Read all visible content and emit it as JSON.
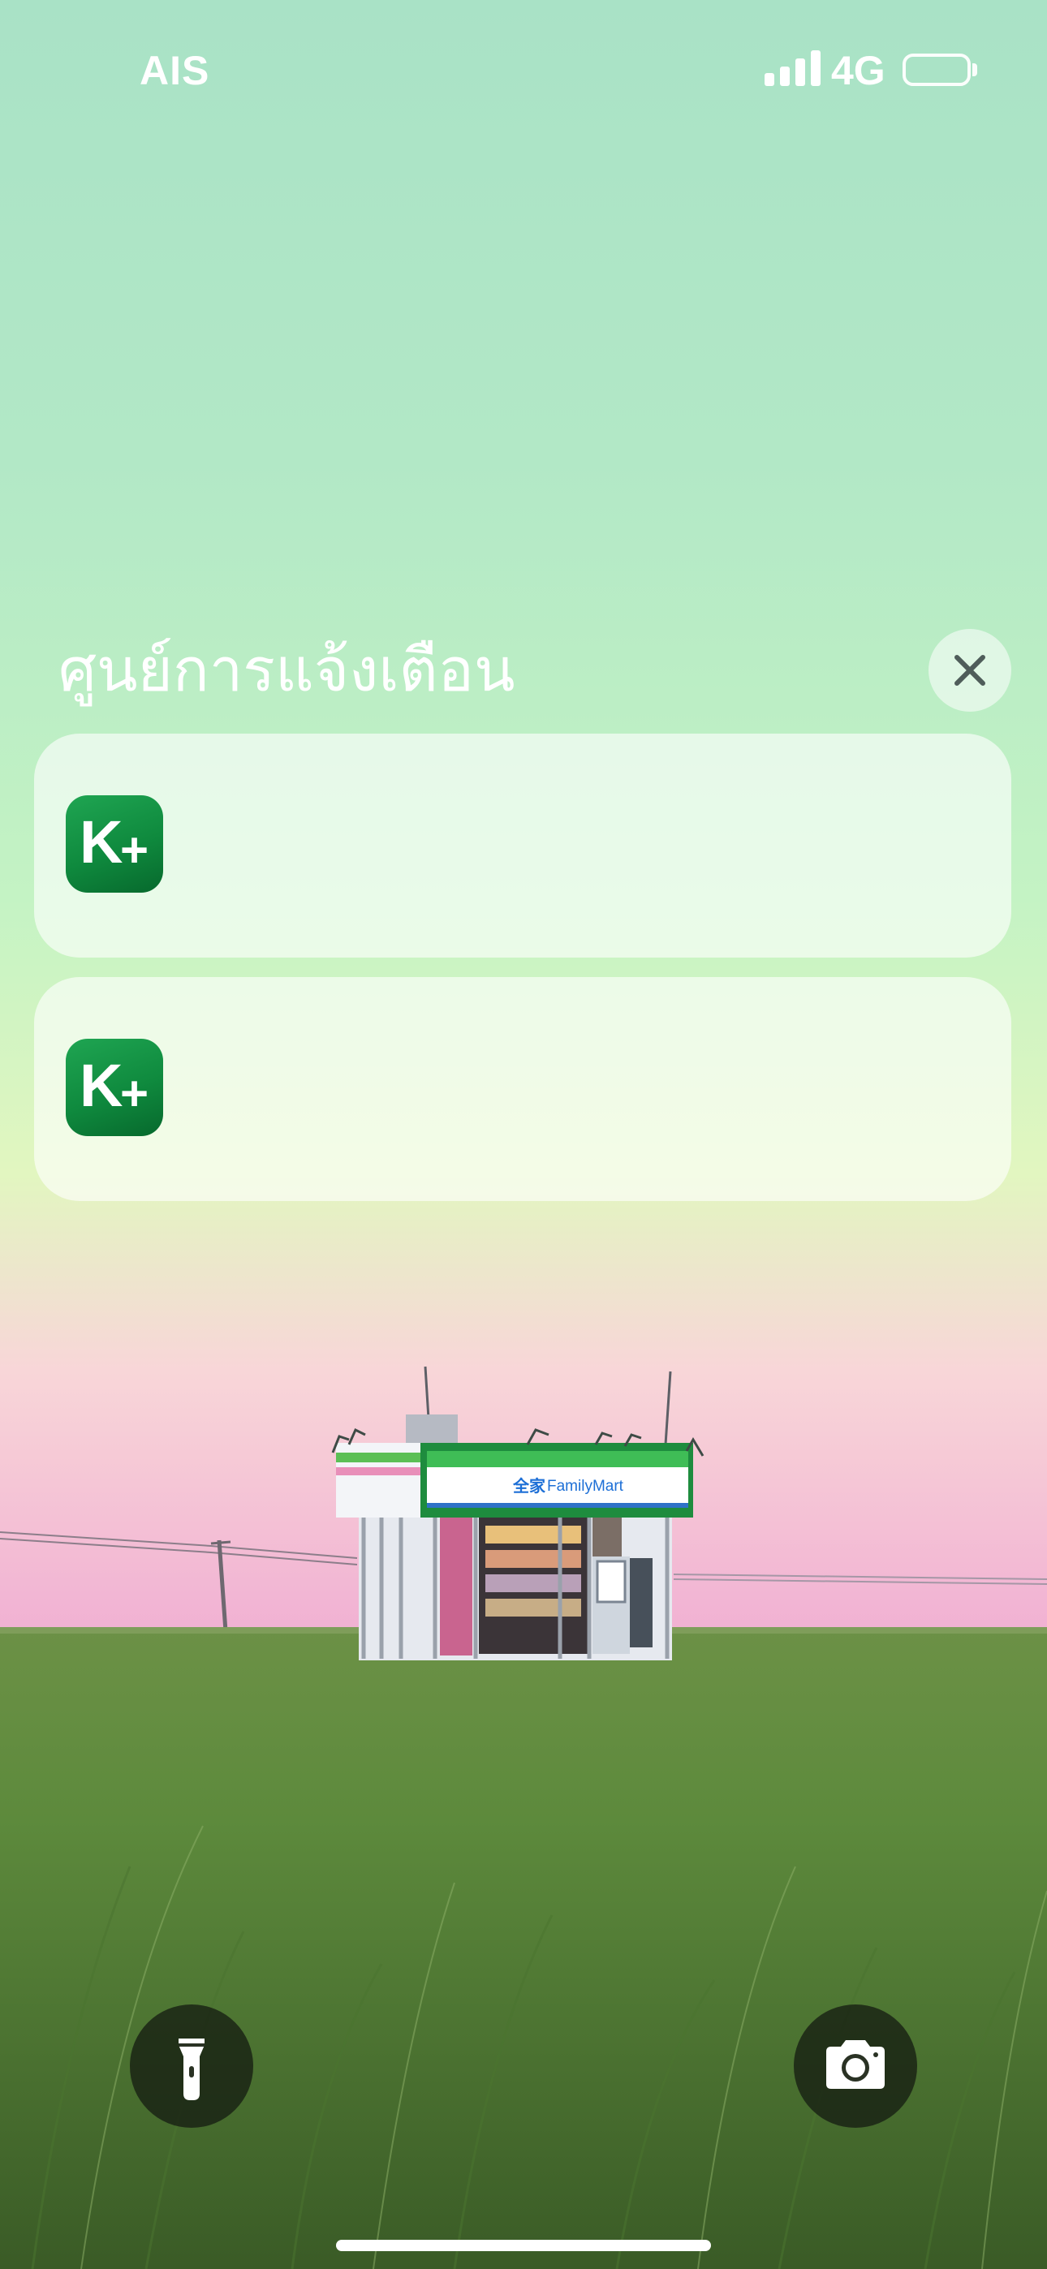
{
  "status_bar": {
    "carrier": "AIS",
    "network": "4G",
    "signal_icon": "cellular-signal-icon",
    "battery_icon": "battery-icon"
  },
  "notification_center": {
    "title": "ศูนย์การแจ้งเตือน",
    "close_icon": "close-icon",
    "notifications": [
      {
        "app_icon_label": "K",
        "app_icon_plus": "+",
        "icon": "kplus-app-icon"
      },
      {
        "app_icon_label": "K",
        "app_icon_plus": "+",
        "icon": "kplus-app-icon"
      }
    ]
  },
  "wallpaper": {
    "store_sign_chinese": "全家",
    "store_sign": "FamilyMart"
  },
  "quick_actions": {
    "flashlight_icon": "flashlight-icon",
    "camera_icon": "camera-icon"
  },
  "colors": {
    "sky_top": "#a9e2c6",
    "sky_pink": "#f3b3d4",
    "grass": "#5d8a3c",
    "kplus_green": "#0f8a3e",
    "familymart_green": "#1e9e4a",
    "familymart_blue": "#1d6fd6"
  }
}
